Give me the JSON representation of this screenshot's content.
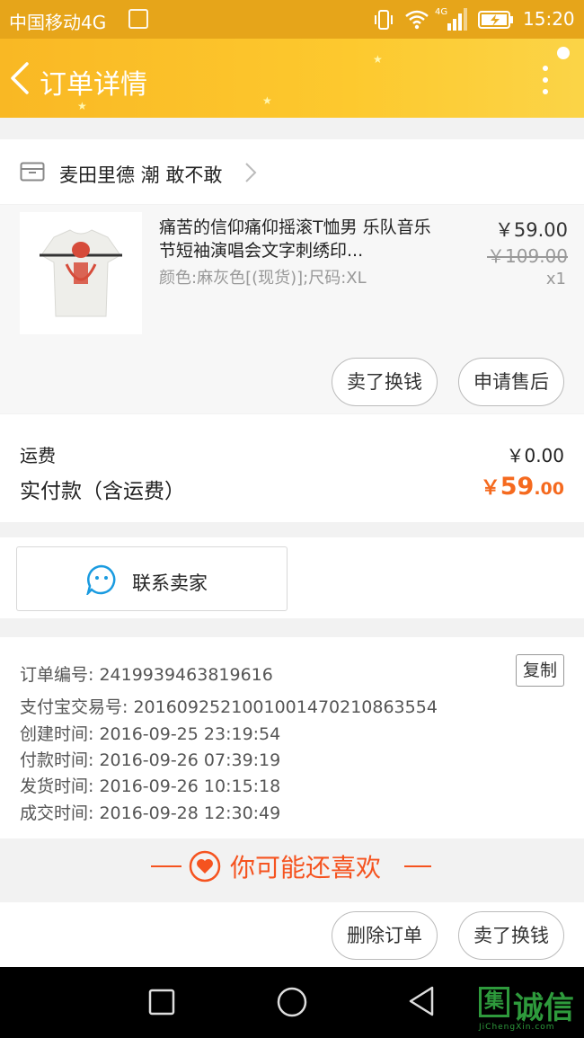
{
  "status_bar": {
    "carrier": "中国移动4G",
    "network_badge": "4G",
    "time": "15:20"
  },
  "header": {
    "title": "订单详情"
  },
  "shop": {
    "name": "麦田里德 潮 敢不敢"
  },
  "product": {
    "title": "痛苦的信仰痛仰摇滚T恤男 乐队音乐节短袖演唱会文字刺绣印...",
    "sku": "颜色:麻灰色[(现货)];尺码:XL",
    "price": "￥59.00",
    "original_price": "￥109.00",
    "quantity": "x1",
    "buttons": {
      "resell": "卖了换钱",
      "after_sale": "申请售后"
    }
  },
  "fees": {
    "shipping_label": "运费",
    "shipping_value": "￥0.00",
    "paid_label": "实付款（含运费）",
    "paid_currency": "￥",
    "paid_integer": "59",
    "paid_decimal": ".00"
  },
  "contact": {
    "label": "联系卖家"
  },
  "order_info": {
    "copy_label": "复制",
    "lines": [
      "订单编号: 2419939463819616",
      "支付宝交易号: 2016092521001001470210863554",
      "创建时间: 2016-09-25 23:19:54",
      "付款时间: 2016-09-26 07:39:19",
      "发货时间: 2016-09-26 10:15:18",
      "成交时间: 2016-09-28 12:30:49"
    ]
  },
  "recommend": {
    "title": "你可能还喜欢"
  },
  "bottom_actions": {
    "delete": "删除订单",
    "resell": "卖了换钱"
  },
  "watermark": {
    "box_char": "集",
    "text": "诚信",
    "sub": "JiChengXin.com"
  },
  "colors": {
    "status_bar": "#e6a51a",
    "header": "#fdc92e",
    "accent_orange": "#f56a1f",
    "recommend_red": "#f5531f",
    "contact_blue": "#1a9be0"
  }
}
